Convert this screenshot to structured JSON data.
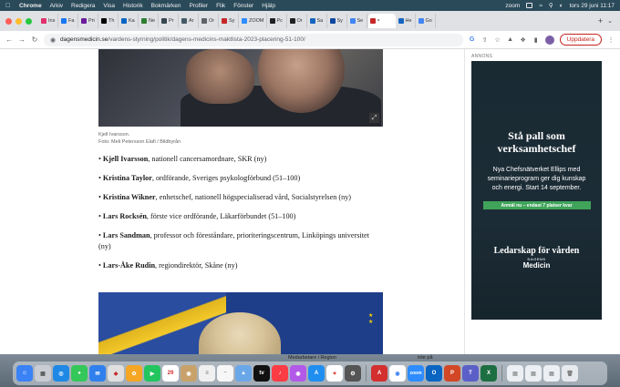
{
  "menubar": {
    "app": "Chrome",
    "items": [
      "Arkiv",
      "Redigera",
      "Visa",
      "Historik",
      "Bokmärken",
      "Profiler",
      "Flik",
      "Fönster",
      "Hjälp"
    ],
    "zoom": "zoom",
    "datetime": "tors 29 juni 11:17"
  },
  "tabs": [
    {
      "label": "Ins",
      "color": "#e1306c"
    },
    {
      "label": "Fa",
      "color": "#1877f2"
    },
    {
      "label": "Pri",
      "color": "#6a1b9a"
    },
    {
      "label": "Th",
      "color": "#000000"
    },
    {
      "label": "Ka",
      "color": "#0a66c2"
    },
    {
      "label": "Ne",
      "color": "#2e7d32"
    },
    {
      "label": "Pr",
      "color": "#37474f"
    },
    {
      "label": "Ar",
      "color": "#455a64"
    },
    {
      "label": "Or",
      "color": "#5f6368"
    },
    {
      "label": "Sy",
      "color": "#c62828"
    },
    {
      "label": "ZOOM",
      "color": "#2d8cff"
    },
    {
      "label": "Pc",
      "color": "#212121"
    },
    {
      "label": "Or",
      "color": "#212121"
    },
    {
      "label": "Sa",
      "color": "#1565c0"
    },
    {
      "label": "Sy",
      "color": "#0d47a1"
    },
    {
      "label": "Se",
      "color": "#4285f4"
    },
    {
      "label": "×",
      "color": "#c62828",
      "active": true
    },
    {
      "label": "He",
      "color": "#1565c0"
    },
    {
      "label": "Go",
      "color": "#4285f4"
    }
  ],
  "toolbar": {
    "url_domain": "dagensmedicin.se",
    "url_path": "/vardens-styrning/politik/dagens-medicins-maktlista-2023-placering-51-100/",
    "update_label": "Uppdatera"
  },
  "article": {
    "caption_name": "Kjell Ivarsson.",
    "caption_credit": "Foto: Meli Petersson Elafi / Bildbyrån",
    "entries": [
      {
        "name": "Kjell Ivarsson",
        "rest": ", nationell cancersamordnare, SKR (ny)"
      },
      {
        "name": "Kristina Taylor",
        "rest": ", ordförande, Sveriges psykologförbund (51–100)"
      },
      {
        "name": "Kristina Wikner",
        "rest": ", enhetschef, nationell högspecialiserad vård, Socialstyrelsen (ny)"
      },
      {
        "name": "Lars Rocksén",
        "rest": ", förste vice ordförande, Läkarförbundet (51–100)"
      },
      {
        "name": "Lars Sandman",
        "rest": ", professor och föreståndare, prioriteringscentrum, Linköpings universitet (ny)"
      },
      {
        "name": "Lars-Åke Rudin",
        "rest": ", regiondirektör, Skåne (ny)"
      }
    ]
  },
  "ad": {
    "label": "ANNONS",
    "headline": "Stå pall som verksamhetschef",
    "body": "Nya Chefsnätverket Ellips med seminarieprogram ger dig kunskap och energi. Start 14 september.",
    "cta": "Anmäl nu – endast 7 platser kvar",
    "footer": "Ledarskap för vården",
    "brand_top": "DAGENS",
    "brand": "Medicin"
  },
  "dock": {
    "label_1": "Medarbetare i Region",
    "label_2": "inte på"
  }
}
